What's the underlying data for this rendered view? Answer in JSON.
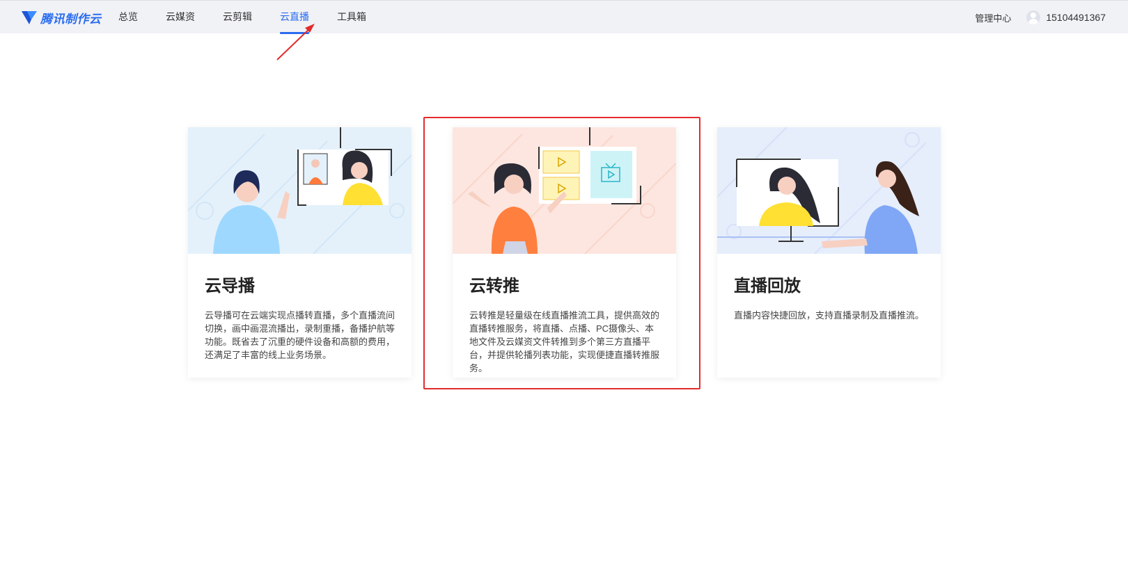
{
  "header": {
    "logo_text": "腾讯制作云",
    "nav": [
      {
        "label": "总览"
      },
      {
        "label": "云媒资"
      },
      {
        "label": "云剪辑"
      },
      {
        "label": "云直播"
      },
      {
        "label": "工具箱"
      }
    ],
    "active_nav": "云直播",
    "admin_link": "管理中心",
    "username": "15104491367"
  },
  "cards": [
    {
      "title": "云导播",
      "desc": "云导播可在云端实现点播转直播，多个直播流间切换，画中画混流播出，录制重播，备播护航等功能。既省去了沉重的硬件设备和高额的费用，还满足了丰富的线上业务场景。"
    },
    {
      "title": "云转推",
      "desc": "云转推是轻量级在线直播推流工具，提供高效的直播转推服务，将直播、点播、PC摄像头、本地文件及云媒资文件转推到多个第三方直播平台，并提供轮播列表功能，实现便捷直播转推服务。"
    },
    {
      "title": "直播回放",
      "desc": "直播内容快捷回放，支持直播录制及直播推流。"
    }
  ],
  "colors": {
    "accent": "#2a6cf0",
    "annotation": "#e22b2b",
    "card1_bg": "#e4f1fb",
    "card2_bg": "#fde6df",
    "card3_bg": "#e6eefc"
  }
}
